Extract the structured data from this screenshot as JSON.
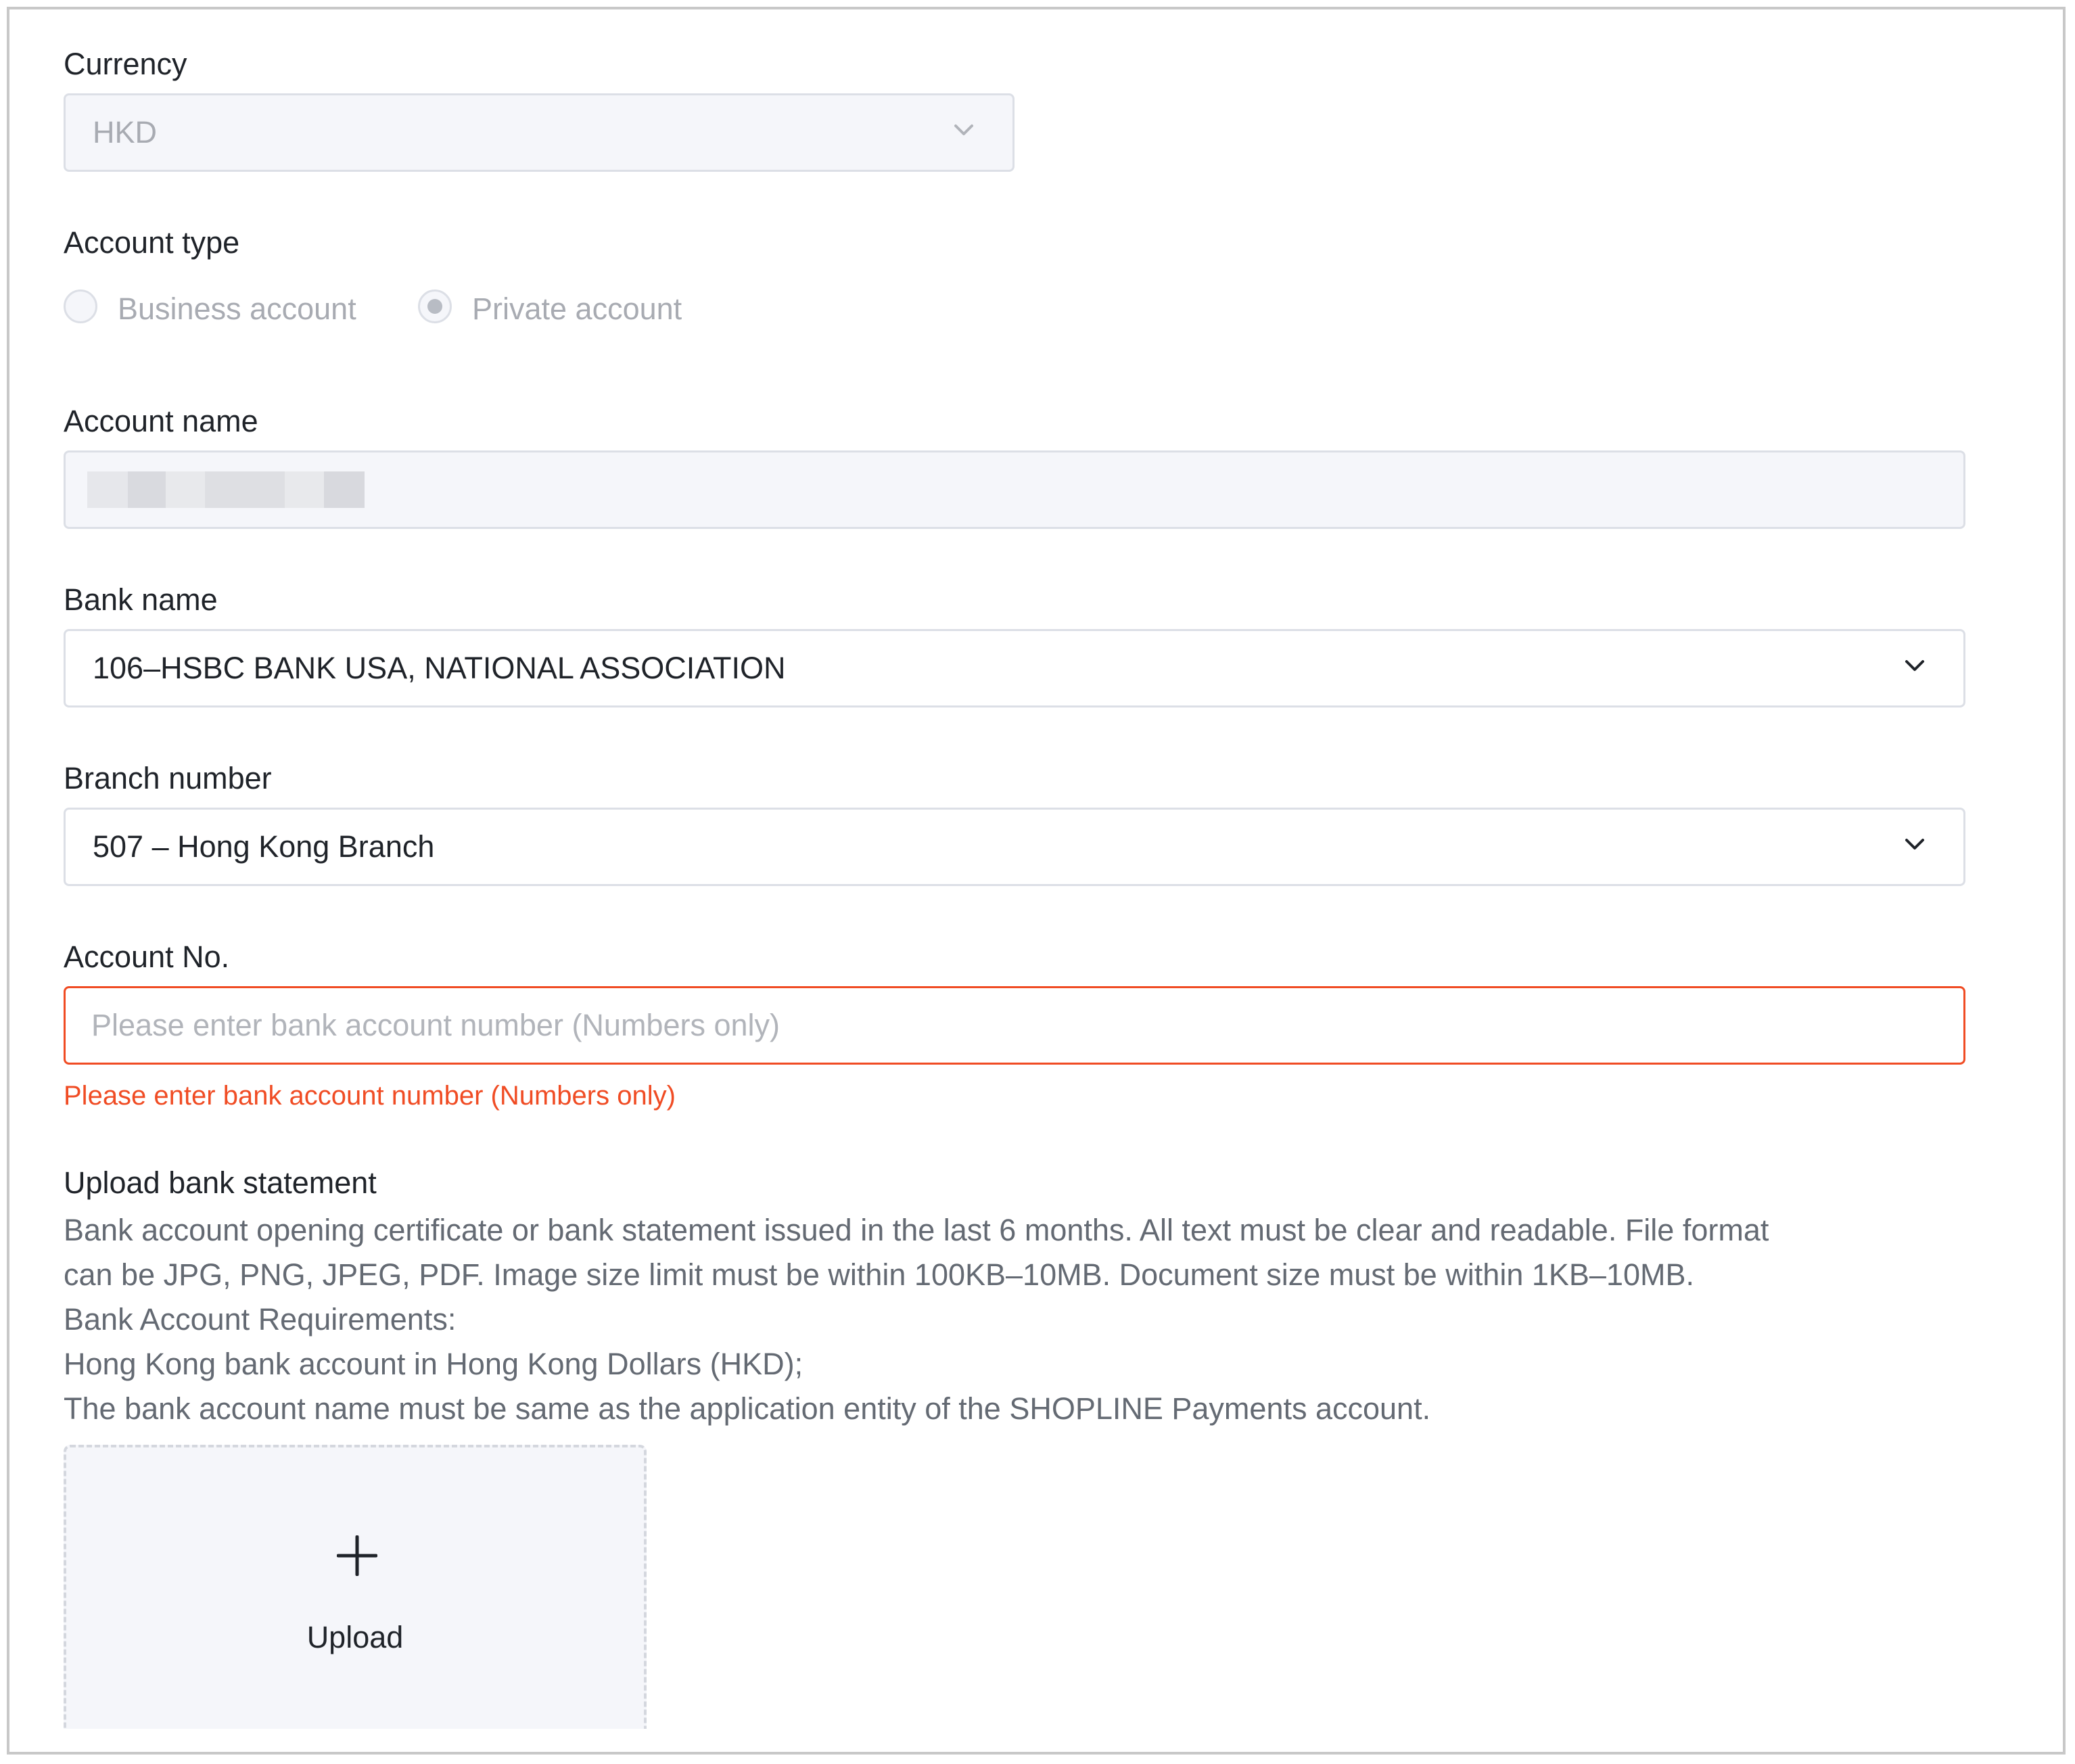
{
  "currency": {
    "label": "Currency",
    "value": "HKD"
  },
  "account_type": {
    "label": "Account type",
    "options": [
      {
        "label": "Business account",
        "selected": false
      },
      {
        "label": "Private account",
        "selected": true
      }
    ]
  },
  "account_name": {
    "label": "Account name"
  },
  "bank_name": {
    "label": "Bank name",
    "value": "106–HSBC BANK USA, NATIONAL ASSOCIATION"
  },
  "branch_number": {
    "label": "Branch number",
    "value": "507 – Hong Kong Branch"
  },
  "account_no": {
    "label": "Account No.",
    "value": "",
    "placeholder": "Please enter bank account number (Numbers only)",
    "error": "Please enter bank account number (Numbers only)"
  },
  "upload_statement": {
    "label": "Upload bank statement",
    "description_lines": [
      "Bank account opening certificate or bank statement issued in the last 6 months. All text must be clear and readable. File format",
      "can be JPG,  PNG, JPEG, PDF. Image size limit must be within 100KB–10MB. Document size must be within 1KB–10MB.",
      "Bank Account Requirements:",
      "Hong Kong bank account in Hong Kong Dollars (HKD);",
      "The bank account name must be same as the application entity of the SHOPLINE Payments account."
    ],
    "button_label": "Upload"
  },
  "icons": {
    "dropdown": "chevron-down-icon",
    "upload": "plus-icon"
  },
  "colors": {
    "error": "#f04c24",
    "border": "#dcdfe6",
    "disabled_bg": "#f5f6fa"
  }
}
